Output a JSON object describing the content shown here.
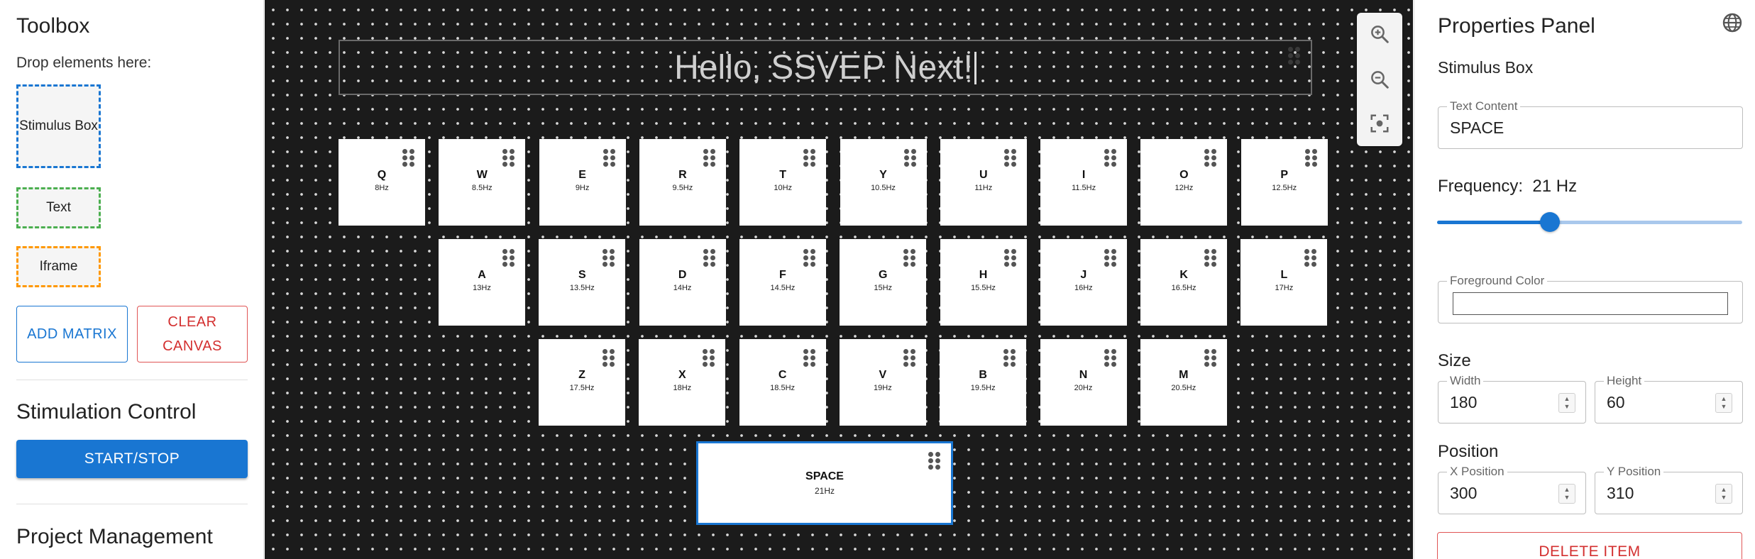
{
  "toolbox": {
    "title": "Toolbox",
    "drop_hint": "Drop elements here:",
    "items": [
      {
        "label": "Stimulus Box",
        "color": "#1976d2"
      },
      {
        "label": "Text",
        "color": "#4caf50"
      },
      {
        "label": "Iframe",
        "color": "#ff9800"
      }
    ],
    "add_matrix_label": "ADD MATRIX",
    "clear_canvas_label": "CLEAR CANVAS"
  },
  "stimulation": {
    "title": "Stimulation Control",
    "start_stop_label": "START/STOP"
  },
  "project": {
    "title": "Project Management"
  },
  "canvas": {
    "banner_text": "Hello, SSVEP Next!",
    "rows": [
      [
        {
          "letter": "Q",
          "freq": "8Hz"
        },
        {
          "letter": "W",
          "freq": "8.5Hz"
        },
        {
          "letter": "E",
          "freq": "9Hz"
        },
        {
          "letter": "R",
          "freq": "9.5Hz"
        },
        {
          "letter": "T",
          "freq": "10Hz"
        },
        {
          "letter": "Y",
          "freq": "10.5Hz"
        },
        {
          "letter": "U",
          "freq": "11Hz"
        },
        {
          "letter": "I",
          "freq": "11.5Hz"
        },
        {
          "letter": "O",
          "freq": "12Hz"
        },
        {
          "letter": "P",
          "freq": "12.5Hz"
        }
      ],
      [
        {
          "letter": "A",
          "freq": "13Hz"
        },
        {
          "letter": "S",
          "freq": "13.5Hz"
        },
        {
          "letter": "D",
          "freq": "14Hz"
        },
        {
          "letter": "F",
          "freq": "14.5Hz"
        },
        {
          "letter": "G",
          "freq": "15Hz"
        },
        {
          "letter": "H",
          "freq": "15.5Hz"
        },
        {
          "letter": "J",
          "freq": "16Hz"
        },
        {
          "letter": "K",
          "freq": "16.5Hz"
        },
        {
          "letter": "L",
          "freq": "17Hz"
        }
      ],
      [
        {
          "letter": "Z",
          "freq": "17.5Hz"
        },
        {
          "letter": "X",
          "freq": "18Hz"
        },
        {
          "letter": "C",
          "freq": "18.5Hz"
        },
        {
          "letter": "V",
          "freq": "19Hz"
        },
        {
          "letter": "B",
          "freq": "19.5Hz"
        },
        {
          "letter": "N",
          "freq": "20Hz"
        },
        {
          "letter": "M",
          "freq": "20.5Hz"
        }
      ]
    ],
    "space": {
      "letter": "SPACE",
      "freq": "21Hz"
    },
    "zoom_controls": [
      "zoom-in-icon",
      "zoom-out-icon",
      "fit-screen-icon"
    ]
  },
  "properties": {
    "title": "Properties Panel",
    "element_type": "Stimulus Box",
    "text_content_label": "Text Content",
    "text_content_value": "SPACE",
    "frequency_label": "Frequency:",
    "frequency_value": "21 Hz",
    "frequency_slider_fraction": 0.37,
    "foreground_color_label": "Foreground Color",
    "size_label": "Size",
    "width_label": "Width",
    "width_value": "180",
    "height_label": "Height",
    "height_value": "60",
    "position_label": "Position",
    "x_label": "X Position",
    "x_value": "300",
    "y_label": "Y Position",
    "y_value": "310",
    "delete_label": "DELETE ITEM",
    "language_icon": "globe-icon"
  },
  "colors": {
    "accent": "#1976d2",
    "danger": "#d32f2f",
    "canvas_bg": "#1b1b1b"
  }
}
